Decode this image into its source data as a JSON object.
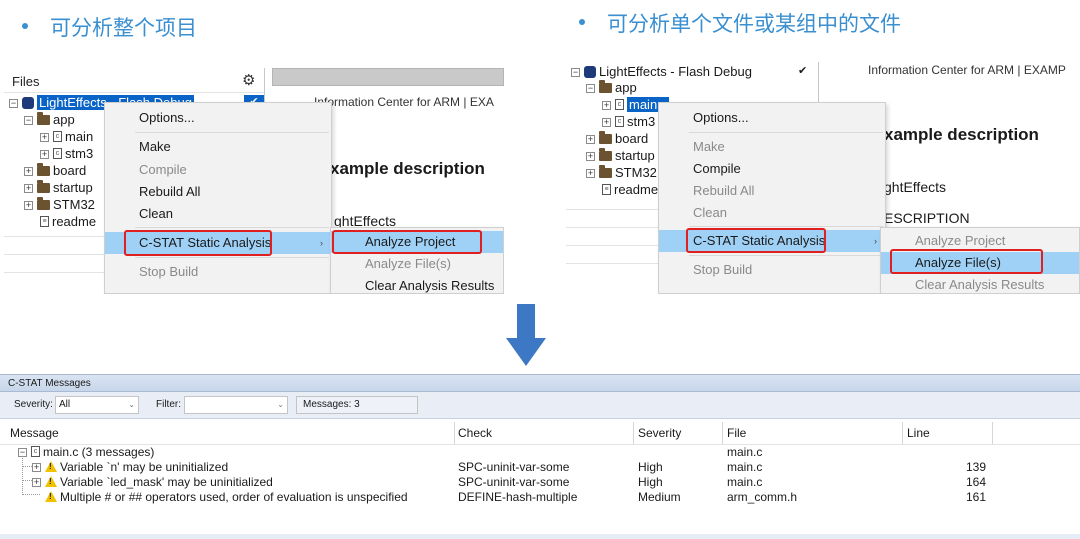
{
  "headings": {
    "left": "可分析整个项目",
    "right": "可分析单个文件或某组中的文件"
  },
  "left_panel": {
    "files_title": "Files",
    "gear_icon": "gear-icon",
    "project": "LightEffects - Flash Debug",
    "check_mark": "✔",
    "tree": [
      "app",
      "main",
      "stm3",
      "board",
      "startup",
      "STM32",
      "readme"
    ],
    "info_tab": "Information Center for ARM | EXA",
    "example_title": "xample description",
    "example_line": "ghtEffects",
    "menu": {
      "items": [
        "Options...",
        "Make",
        "Compile",
        "Rebuild All",
        "Clean",
        "C-STAT Static Analysis",
        "Stop Build"
      ]
    },
    "submenu": {
      "items": [
        "Analyze Project",
        "Analyze File(s)",
        "Clear Analysis Results"
      ]
    }
  },
  "right_panel": {
    "project": "LightEffects - Flash Debug",
    "check_mark": "✔",
    "tree": [
      "app",
      "main.c",
      "stm3",
      "board",
      "startup",
      "STM32",
      "readme"
    ],
    "info_tab": "Information Center for ARM | EXAMP",
    "example_title": "xample description",
    "example_line": "ghtEffects",
    "example_line2": "ESCRIPTION",
    "menu": {
      "items": [
        "Options...",
        "Make",
        "Compile",
        "Rebuild All",
        "Clean",
        "C-STAT Static Analysis",
        "Stop Build"
      ]
    },
    "submenu": {
      "items": [
        "Analyze Project",
        "Analyze File(s)",
        "Clear Analysis Results"
      ]
    }
  },
  "cstat": {
    "title": "C-STAT Messages",
    "severity_label": "Severity:",
    "severity_value": "All",
    "filter_label": "Filter:",
    "filter_value": "",
    "messages_count": "Messages: 3",
    "columns": [
      "Message",
      "Check",
      "Severity",
      "File",
      "Line"
    ],
    "group": {
      "label": "main.c  (3 messages)",
      "file": "main.c"
    },
    "rows": [
      {
        "message": "Variable `n' may be uninitialized",
        "check": "SPC-uninit-var-some",
        "severity": "High",
        "file": "main.c",
        "line": "139"
      },
      {
        "message": "Variable `led_mask' may be uninitialized",
        "check": "SPC-uninit-var-some",
        "severity": "High",
        "file": "main.c",
        "line": "164"
      },
      {
        "message": "Multiple # or ## operators used, order of evaluation is unspecified",
        "check": "DEFINE-hash-multiple",
        "severity": "Medium",
        "file": "arm_comm.h",
        "line": "161"
      }
    ]
  },
  "colors": {
    "heading": "#3a8fd0",
    "selection": "#0a64c8",
    "menu_highlight": "#9fd0f5",
    "annotation_red": "#e02020",
    "arrow_blue": "#3d78c4",
    "warning": "#f2c200"
  }
}
